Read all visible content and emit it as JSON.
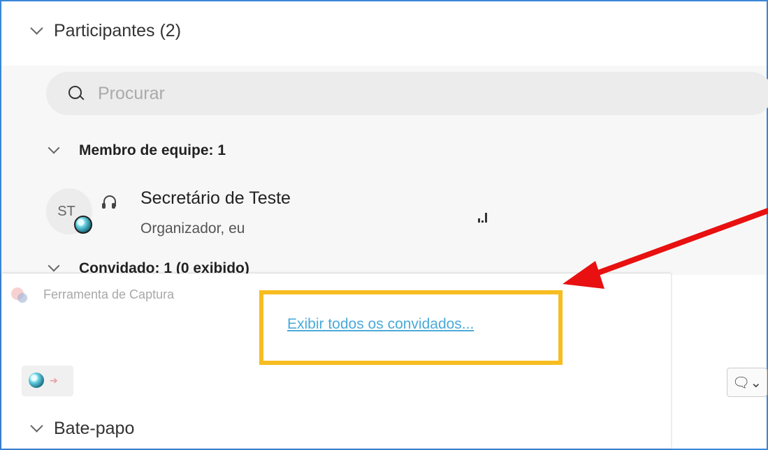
{
  "participants": {
    "title": "Participantes (2)",
    "search_placeholder": "Procurar"
  },
  "groups": {
    "team": {
      "label": "Membro de equipe: 1",
      "members": [
        {
          "initials": "ST",
          "name": "Secretário de Teste",
          "role": "Organizador, eu",
          "signal": "0ıl"
        }
      ]
    },
    "guests": {
      "label": "Convidado: 1 (0 exibido)"
    }
  },
  "popup": {
    "tool_title": "Ferramenta de Captura",
    "link": "Exibir todos os convidados...",
    "megaphone_label": "🗨⌄"
  },
  "chat": {
    "title": "Bate-papo"
  },
  "colors": {
    "highlight_box": "#f7bc1f",
    "arrow": "#e81010",
    "link": "#4aaad8",
    "frame": "#3a86d8"
  },
  "icons": [
    "chevron-down-icon",
    "search-icon",
    "headset-icon",
    "signal-icon",
    "megaphone-icon",
    "snipping-tool-icon"
  ]
}
